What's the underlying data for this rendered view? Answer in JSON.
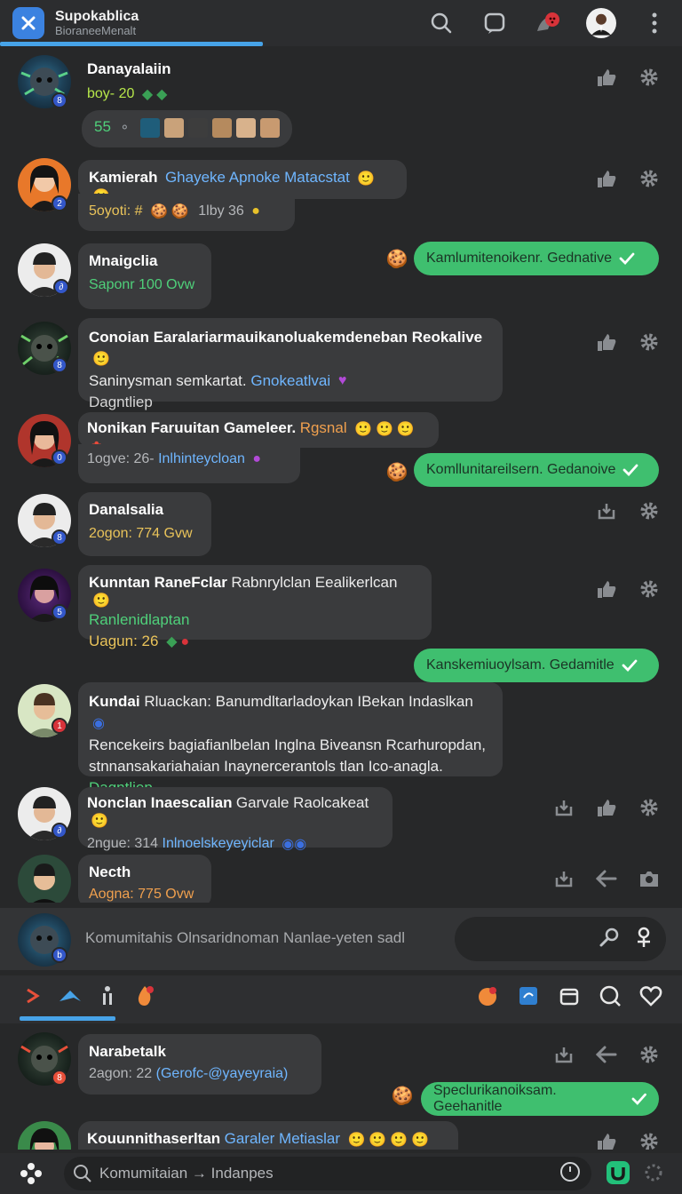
{
  "app": {
    "title": "Supokablica",
    "subtitle": "BioraneeMenalt"
  },
  "feed": [
    {
      "name": "Danayalaiin",
      "sub": "boy- 20",
      "count": "55"
    },
    {
      "name": "Kamierah",
      "name_rest": "Ghayeke Apnoke Matacstat",
      "sub": "5oyoti:  #",
      "sub2": "1lby 36"
    },
    {
      "name": "Mnaigclia",
      "sub": "Saponr 100 Ovw"
    },
    {
      "name": "Conoian Earalariarmauikanoluakemdeneban Reokalive",
      "line2": "Saninysman semkartat.",
      "line2_hl": "Gnokeatlvai",
      "line3": "Dagntliep"
    },
    {
      "name": "Nonikan Faruuitan Gameleer.",
      "name_hl": "Rgsnal",
      "sub": "1ogve: 26-",
      "sub_hl": "Inlhinteycloan"
    },
    {
      "name": "Danalsalia",
      "sub": "2ogon: 774 Gvw"
    },
    {
      "name": "Kunntan RaneFclar",
      "name_rest": "Rabnrylclan Eealikerlcan",
      "line2": "Ranlenidlaptan",
      "line3": "Uagun: 26"
    },
    {
      "name": "Kundai",
      "name_rest": "Rluackan: Banumdltarladoykan IBekan Indaslkan",
      "line2": "Rencekeirs bagiafianlbelan Inglna Biveansn Rcarhuropdan,",
      "line3": "stnnansakariahaian Inaynercerantols tlan Ico-anagla.",
      "line4": "Dagntliep"
    },
    {
      "name": "Nonclan Inaescalian",
      "name_rest": "Garvale Raolcakeat",
      "sub": "2ngue: 314",
      "sub_hl": "Inlnoelskeyeyiclar"
    },
    {
      "name": "Necth",
      "sub": "Aogna: 775 Ovw"
    }
  ],
  "sent": [
    "Kamlumitenoikenr. Gednative",
    "Komllunitareilsern. Gedanoive",
    "Kanskemiuoylsam. Gedamitle",
    "Speclurikanoiksam. Geehanitle"
  ],
  "composer": {
    "placeholder": "Komumitahis Olnsaridnoman Nanlae-yeten sadl"
  },
  "lower": [
    {
      "name": "Narabetalk",
      "sub": "2agon: 22",
      "sub_hl": "(Gerofc-@yayeyraia)"
    },
    {
      "name": "Kouunnithaserltan",
      "name_rest": "Garaler Metiaslar"
    }
  ],
  "bottom": {
    "search_placeholder": "Komumitaian → Indanpes"
  },
  "colors": {
    "accent": "#47a3e8",
    "sent_bubble": "#3fbf6f",
    "background": "#272829",
    "bubble": "#3a3b3d"
  },
  "icons": [
    "close-x-icon",
    "search-icon",
    "chat-icon",
    "notification-bell-icon",
    "profile-avatar",
    "more-vertical-icon",
    "thumbs-up-icon",
    "settings-gear-icon",
    "share-icon",
    "bookmark-icon",
    "checkmark-icon",
    "key-icon",
    "person-icon",
    "arrow-right-icon",
    "plane-icon",
    "walk-icon",
    "fire-icon",
    "fire-chat-icon",
    "link-icon",
    "inbox-icon",
    "chat-search-icon",
    "heart-icon",
    "grid-icon",
    "clock-icon",
    "u-app-icon",
    "loading-icon"
  ]
}
